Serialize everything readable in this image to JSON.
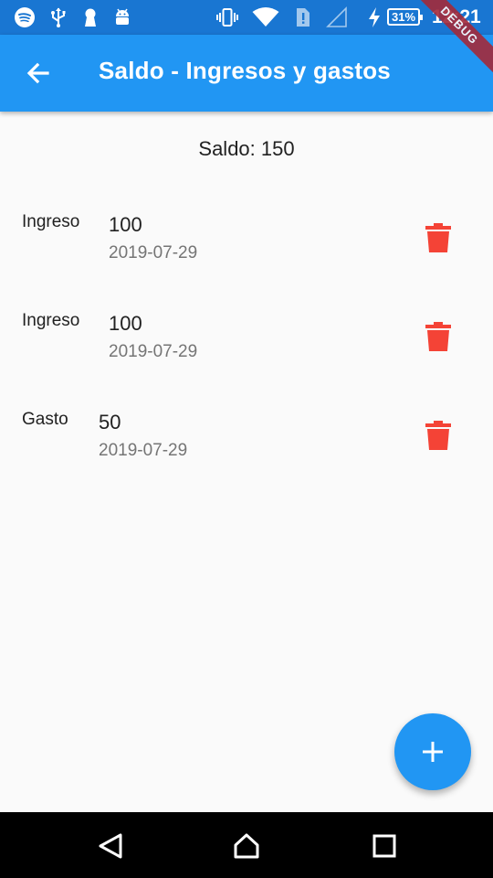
{
  "status_bar": {
    "battery": "31%",
    "time": "12:21",
    "icons": [
      "spotify-icon",
      "usb-icon",
      "keyhole-icon",
      "android-icon",
      "vibrate-icon",
      "wifi-icon",
      "sim-alert-icon",
      "no-signal-icon",
      "charging-icon",
      "battery-icon"
    ]
  },
  "debug_banner": "DEBUG",
  "app_bar": {
    "title": "Saldo - Ingresos y gastos",
    "back_icon": "arrow-back-icon"
  },
  "balance": {
    "label": "Saldo: 150"
  },
  "transactions": [
    {
      "type": "Ingreso",
      "amount": "100",
      "date": "2019-07-29"
    },
    {
      "type": "Ingreso",
      "amount": "100",
      "date": "2019-07-29"
    },
    {
      "type": "Gasto",
      "amount": "50",
      "date": "2019-07-29"
    }
  ],
  "colors": {
    "primary": "#2196f3",
    "primary_dark": "#1976d2",
    "delete": "#f44336",
    "background": "#fafafa"
  },
  "fab": {
    "icon": "plus-icon"
  },
  "nav_bar": {
    "icons": [
      "back-triangle-icon",
      "home-icon",
      "recents-icon"
    ]
  }
}
